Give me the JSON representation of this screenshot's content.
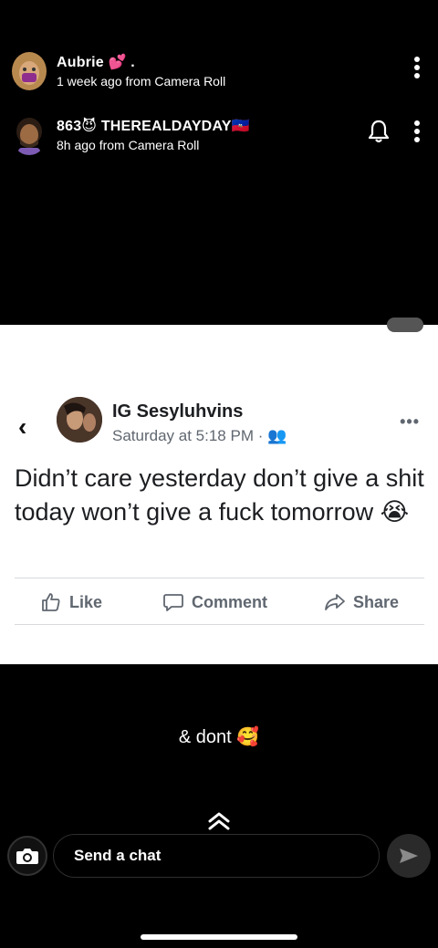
{
  "stories": [
    {
      "username": "Aubrie 💕 .",
      "subtitle": "1 week ago from Camera Roll"
    },
    {
      "username": "863😈 THEREALDAYDAY🇭🇹",
      "subtitle": "8h ago from Camera Roll"
    }
  ],
  "post": {
    "author": "IG Sesyluhvins",
    "time": "Saturday at 5:18 PM · 👥",
    "text": "Didn’t care yesterday don’t give a shit today won’t give a fuck tomorrow 😭",
    "actions": {
      "like": "Like",
      "comment": "Comment",
      "share": "Share"
    },
    "more_label": "•••",
    "back_label": "‹"
  },
  "caption": "& dont 🥰",
  "chat": {
    "placeholder": "Send a chat"
  },
  "colors": {
    "background": "#000000",
    "card": "#ffffff",
    "fb_gray": "#606770"
  },
  "icons": [
    "kebab-icon",
    "bell-icon",
    "camera-icon",
    "send-icon",
    "chevron-up-icon",
    "like-icon",
    "comment-icon",
    "share-icon",
    "back-icon",
    "more-icon"
  ]
}
